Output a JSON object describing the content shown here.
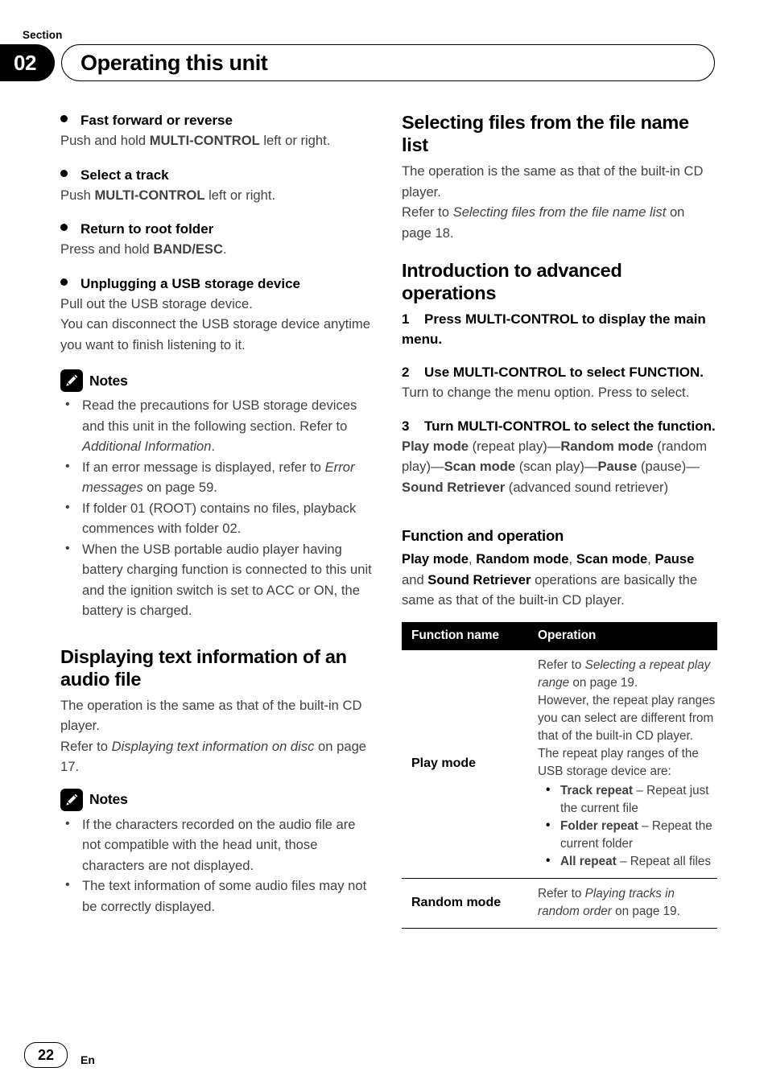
{
  "header": {
    "section_caption": "Section",
    "section_number": "02",
    "title": "Operating this unit"
  },
  "footer": {
    "page_number": "22",
    "language_code": "En"
  },
  "left_column": {
    "operations": [
      {
        "title": "Fast forward or reverse",
        "desc_html": "Push and hold <b>MULTI-CONTROL</b> left or right."
      },
      {
        "title": "Select a track",
        "desc_html": "Push <b>MULTI-CONTROL</b> left or right."
      },
      {
        "title": "Return to root folder",
        "desc_html": "Press and hold <b>BAND/ESC</b>."
      },
      {
        "title": "Unplugging a USB storage device",
        "desc_html": "Pull out the USB storage device.<br>You can disconnect the USB storage device anytime you want to finish listening to it."
      }
    ],
    "notes_1": {
      "icon": "pencil-note-icon",
      "label": "Notes",
      "items_html": [
        "Read the precautions for USB storage devices and this unit in the following section. Refer to <i>Additional Information</i>.",
        "If an error message is displayed, refer to <i>Error messages</i> on page 59.",
        "If folder 01 (ROOT) contains no files, playback commences with folder 02.",
        "When the USB portable audio player having battery charging function is connected to this unit and the ignition switch is set to ACC or ON, the battery is charged."
      ]
    },
    "section_display_text": {
      "heading": "Displaying text information of an audio file",
      "body_html": "The operation is the same as that of the built-in CD player.<br>Refer to <i>Displaying text information on disc</i> on page 17."
    },
    "notes_2": {
      "icon": "pencil-note-icon",
      "label": "Notes",
      "items_html": [
        "If the characters recorded on the audio file are not compatible with the head unit, those characters are not displayed.",
        "The text information of some audio files may not be correctly displayed."
      ]
    }
  },
  "right_column": {
    "section_selecting_files": {
      "heading": "Selecting files from the file name list",
      "body_html": "The operation is the same as that of the built-in CD player.<br>Refer to <i>Selecting files from the file name list</i> on page 18."
    },
    "section_intro_advanced": {
      "heading": "Introduction to advanced operations",
      "steps": [
        {
          "number": "1",
          "head": "Press MULTI-CONTROL to display the main menu.",
          "desc_html": ""
        },
        {
          "number": "2",
          "head": "Use MULTI-CONTROL to select FUNCTION.",
          "desc_html": "Turn to change the menu option. Press to select."
        },
        {
          "number": "3",
          "head": "Turn MULTI-CONTROL to select the function.",
          "desc_html": "<b>Play mode</b> (repeat play)—<b>Random mode</b> (random play)—<b>Scan mode</b> (scan play)—<b>Pause</b> (pause)—<b>Sound Retriever</b> (advanced sound retriever)"
        }
      ]
    },
    "section_function_operation": {
      "heading": "Function and operation",
      "body_html": "<b>Play mode</b>, <b>Random mode</b>, <b>Scan mode</b>, <b>Pause</b> and <b>Sound Retriever</b> operations are basically the same as that of the built-in CD player."
    },
    "table": {
      "columns": [
        "Function name",
        "Operation"
      ],
      "rows": [
        {
          "name": "Play mode",
          "operation_html": "Refer to <i>Selecting a repeat play range</i> on page 19.<br>However, the repeat play ranges you can select are different from that of the built-in CD player. The repeat play ranges of the USB storage device are:",
          "bullets_html": [
            "<b>Track repeat</b> – Repeat just the current file",
            "<b>Folder repeat</b> – Repeat the current folder",
            "<b>All repeat</b> – Repeat all files"
          ]
        },
        {
          "name": "Random mode",
          "operation_html": "Refer to <i>Playing tracks in random order</i> on page 19.",
          "bullets_html": []
        }
      ]
    }
  }
}
